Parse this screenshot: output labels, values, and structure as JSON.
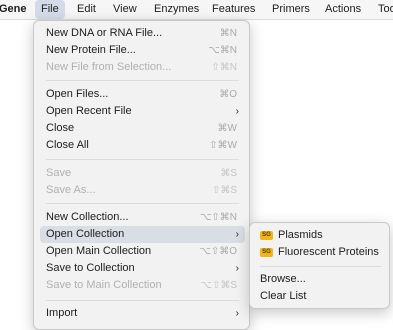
{
  "menubar": {
    "app": "Gene",
    "items": [
      "File",
      "Edit",
      "View",
      "Enzymes",
      "Features",
      "Primers",
      "Actions",
      "Too"
    ]
  },
  "file_menu": {
    "new_dna": {
      "label": "New DNA or RNA File...",
      "shortcut": "⌘N"
    },
    "new_protein": {
      "label": "New Protein File...",
      "shortcut": "⌥⌘N"
    },
    "new_from_selection": {
      "label": "New File from Selection...",
      "shortcut": "⇧⌘N"
    },
    "open_files": {
      "label": "Open Files...",
      "shortcut": "⌘O"
    },
    "open_recent": {
      "label": "Open Recent File"
    },
    "close": {
      "label": "Close",
      "shortcut": "⌘W"
    },
    "close_all": {
      "label": "Close All",
      "shortcut": "⇧⌘W"
    },
    "save": {
      "label": "Save",
      "shortcut": "⌘S"
    },
    "save_as": {
      "label": "Save As...",
      "shortcut": "⇧⌘S"
    },
    "new_collection": {
      "label": "New Collection...",
      "shortcut": "⌥⇧⌘N"
    },
    "open_collection": {
      "label": "Open Collection"
    },
    "open_main_collection": {
      "label": "Open Main Collection",
      "shortcut": "⌥⇧⌘O"
    },
    "save_to_collection": {
      "label": "Save to Collection"
    },
    "save_to_main_collection": {
      "label": "Save to Main Collection",
      "shortcut": "⌥⇧⌘S"
    },
    "import": {
      "label": "Import"
    }
  },
  "collection_submenu": {
    "plasmids": "Plasmids",
    "fluorescent": "Fluorescent Proteins",
    "browse": "Browse...",
    "clear_list": "Clear List",
    "icon_text": "SG"
  },
  "chevron": "›",
  "colors": {
    "highlight": "#d9dde4",
    "disabled": "#b0b0b0",
    "icon": "#f0b41c"
  }
}
